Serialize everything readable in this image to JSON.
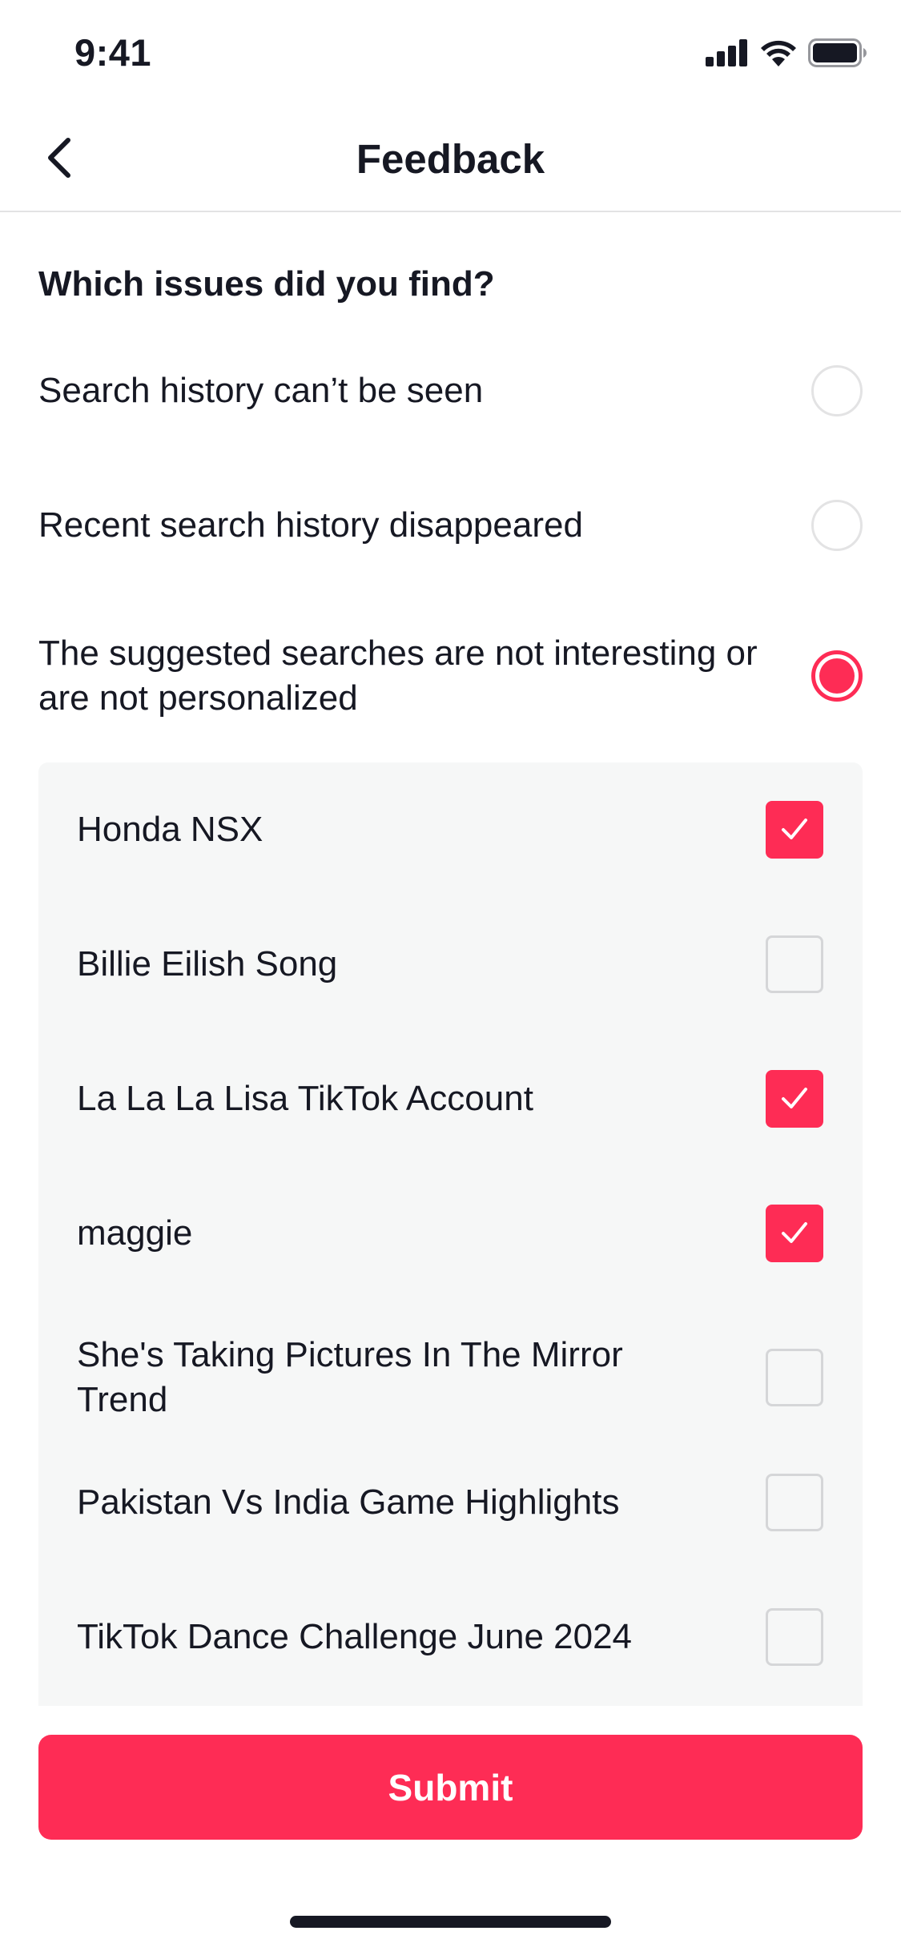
{
  "status_bar": {
    "time": "9:41",
    "icons": [
      "signal-icon",
      "wifi-icon",
      "battery-icon"
    ]
  },
  "nav": {
    "title": "Feedback",
    "back_icon": "chevron-left-icon"
  },
  "question": "Which issues did you find?",
  "options": [
    {
      "label": "Search history can’t be seen",
      "selected": false
    },
    {
      "label": "Recent search history disappeared",
      "selected": false
    },
    {
      "label": "The suggested searches are not interesting or are not personalized",
      "selected": true
    }
  ],
  "suggested_searches": [
    {
      "label": "Honda NSX",
      "checked": true
    },
    {
      "label": "Billie Eilish Song",
      "checked": false
    },
    {
      "label": "La La La Lisa TikTok Account",
      "checked": true
    },
    {
      "label": "maggie",
      "checked": true
    },
    {
      "label": "She's Taking Pictures In The Mirror Trend",
      "checked": false
    },
    {
      "label": "Pakistan Vs India Game Highlights",
      "checked": false
    },
    {
      "label": "TikTok Dance Challenge June 2024",
      "checked": false
    }
  ],
  "submit_label": "Submit",
  "colors": {
    "accent": "#fe2c55",
    "text": "#161823",
    "panel": "#f6f7f7",
    "border": "#e3e3e4"
  }
}
